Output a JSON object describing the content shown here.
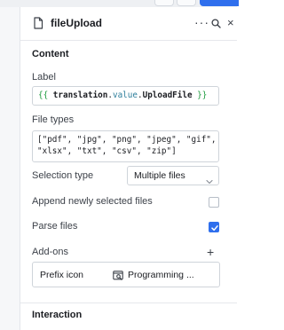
{
  "header": {
    "title": "fileUpload",
    "more_label": "···",
    "close_label": "×"
  },
  "content": {
    "section_title": "Content",
    "label_field": {
      "label": "Label",
      "value": "{{ translation.value.UploadFile }}",
      "tokens": {
        "open": "{{ ",
        "var": "translation",
        "dot1": ".",
        "prop1": "value",
        "dot2": ".",
        "prop2": "UploadFile",
        "close": " }}"
      }
    },
    "file_types": {
      "label": "File types",
      "line1": "[\"pdf\", \"jpg\", \"png\", \"jpeg\", \"gif\",",
      "line2": "\"xlsx\", \"txt\", \"csv\", \"zip\"]"
    },
    "selection_type": {
      "label": "Selection type",
      "value": "Multiple files"
    },
    "append_selected": {
      "label": "Append newly selected files",
      "checked": false
    },
    "parse_files": {
      "label": "Parse files",
      "checked": true
    },
    "addons": {
      "label": "Add-ons",
      "plus_label": "+",
      "items": [
        {
          "name": "Prefix icon",
          "icon": "code-search-icon",
          "value": "Programming ..."
        }
      ]
    }
  },
  "interaction": {
    "section_title": "Interaction"
  },
  "colors": {
    "accent": "#2f6fed",
    "template_brace": "#1a9a3c",
    "template_prop": "#2c7e9b"
  }
}
